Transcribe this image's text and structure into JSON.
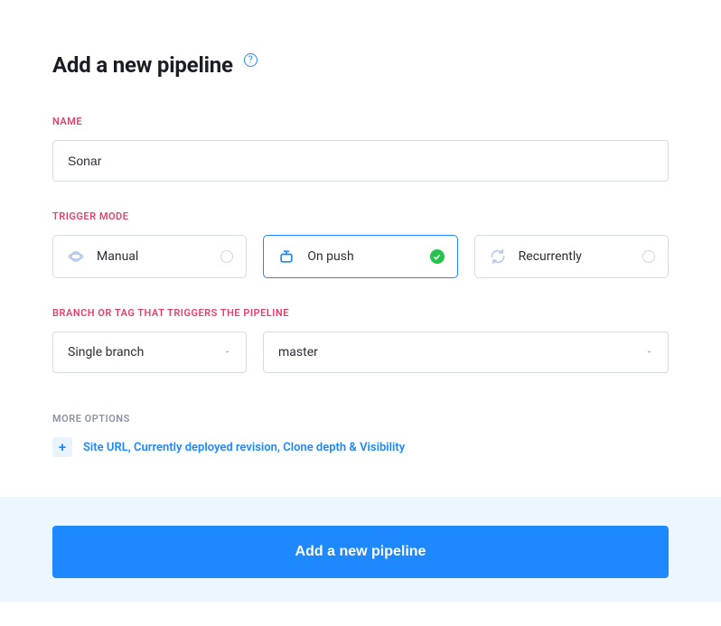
{
  "header": {
    "title": "Add a new pipeline"
  },
  "name_section": {
    "label": "NAME",
    "value": "Sonar"
  },
  "trigger_section": {
    "label": "TRIGGER MODE",
    "options": [
      {
        "id": "manual",
        "label": "Manual",
        "selected": false
      },
      {
        "id": "onpush",
        "label": "On push",
        "selected": true
      },
      {
        "id": "recurrently",
        "label": "Recurrently",
        "selected": false
      }
    ]
  },
  "branch_section": {
    "label": "BRANCH OR TAG THAT TRIGGERS THE PIPELINE",
    "scope": "Single branch",
    "branch": "master"
  },
  "more_section": {
    "label": "MORE OPTIONS",
    "link": "Site URL, Currently deployed revision, Clone depth & Visibility"
  },
  "footer": {
    "submit": "Add a new pipeline"
  }
}
